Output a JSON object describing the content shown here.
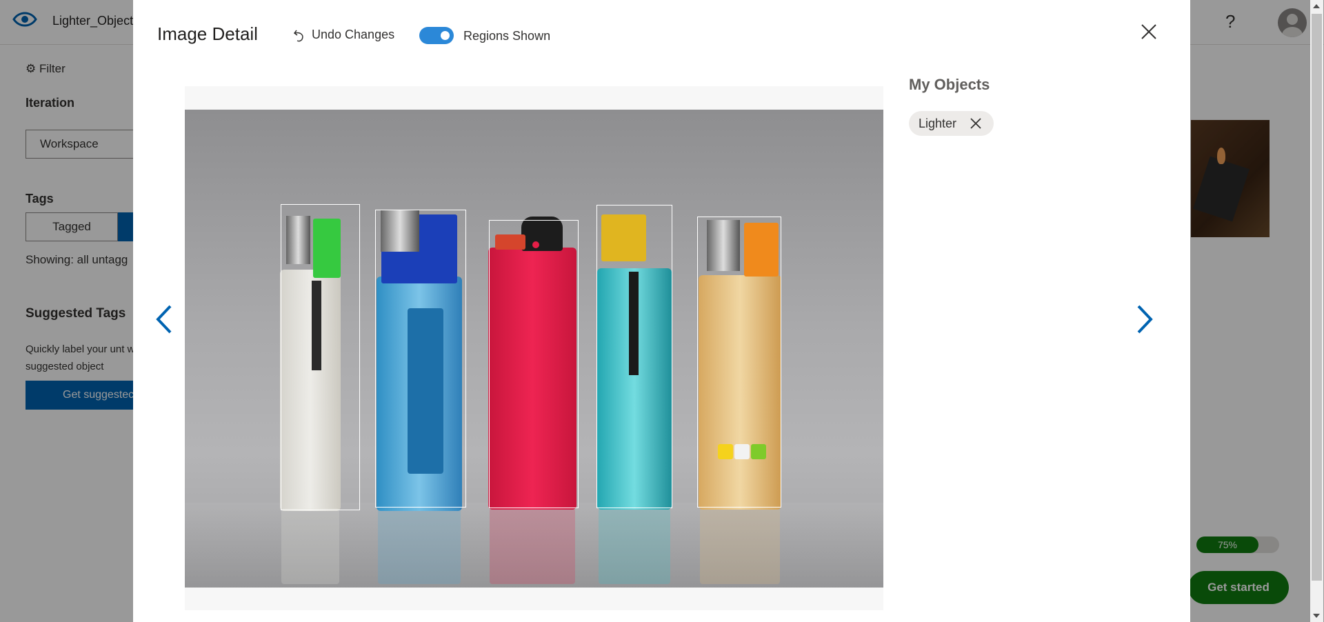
{
  "app": {
    "title": "Lighter_Object",
    "filter_label": "Filter",
    "iteration_label": "Iteration",
    "iteration_value": "Workspace",
    "tags_label": "Tags",
    "tagged_label": "Tagged",
    "showing_text": "Showing: all untagg",
    "suggested_title": "Suggested Tags",
    "suggested_desc": "Quickly label your unt with suggested object",
    "suggested_button": "Get suggestec",
    "progress_value": 0.75,
    "progress_label": "75%",
    "get_started_label": "Get started",
    "help_label": "?"
  },
  "modal": {
    "title": "Image Detail",
    "undo_label": "Undo Changes",
    "regions_toggle": {
      "label": "Regions Shown",
      "on": true,
      "color": "#2b88d8"
    },
    "my_objects_title": "My Objects",
    "objects": [
      {
        "label": "Lighter"
      }
    ],
    "region_count": 5,
    "icons": {
      "undo": "undo-icon",
      "close": "close-icon",
      "prev": "chevron-left-icon",
      "next": "chevron-right-icon",
      "chip_remove": "close-icon"
    },
    "accent_color": "#0063b1"
  },
  "image": {
    "subject": "five lighters",
    "lighter_colors": [
      "#e8e6df",
      "#4aa9d8",
      "#e51e47",
      "#2fc4cc",
      "#e9c07a"
    ],
    "cap_colors": [
      "#36c940",
      "#1b3fb8",
      "#1c1c1c",
      "#e0b520",
      "#f08a1c"
    ]
  }
}
